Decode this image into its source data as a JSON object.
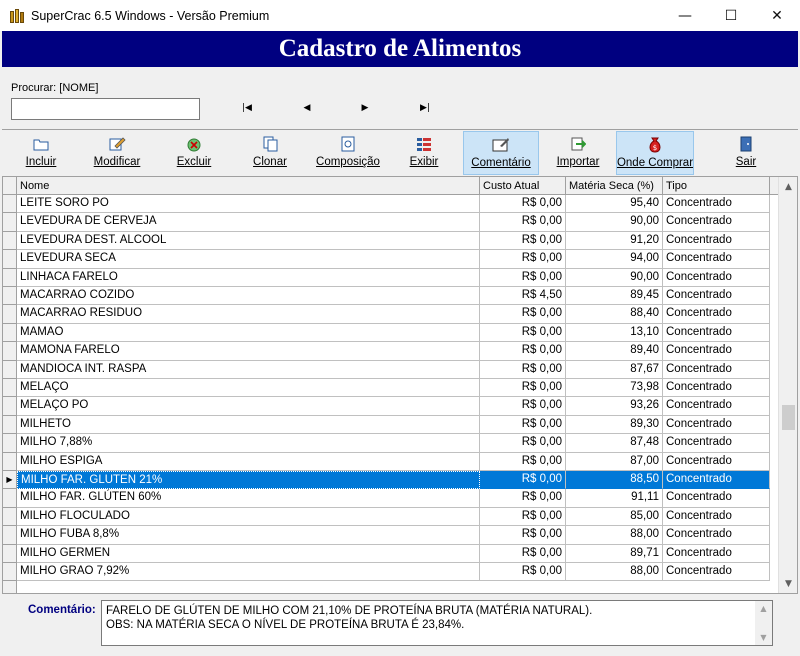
{
  "window": {
    "title": "SuperCrac 6.5 Windows - Versão Premium",
    "minimize": "—",
    "maximize": "☐",
    "close": "✕"
  },
  "banner": {
    "title": "Cadastro de Alimentos"
  },
  "search": {
    "label": "Procurar: [NOME]",
    "value": "",
    "nav": {
      "first": "|◀",
      "prev": "◀",
      "next": "▶",
      "last": "▶|"
    }
  },
  "toolbar": {
    "items": [
      {
        "label": "Incluir",
        "icon": "folder-icon"
      },
      {
        "label": "Modificar",
        "icon": "edit-icon"
      },
      {
        "label": "Excluir",
        "icon": "delete-icon"
      },
      {
        "label": "Clonar",
        "icon": "copy-icon"
      },
      {
        "label": "Composição",
        "icon": "document-icon"
      },
      {
        "label": "Exibir",
        "icon": "list-icon"
      },
      {
        "label": "Comentário",
        "icon": "comment-icon",
        "active": true
      },
      {
        "label": "Importar",
        "icon": "import-icon"
      },
      {
        "label": "Onde Comprar",
        "icon": "money-bag-icon",
        "active": true
      },
      {
        "label": "Sair",
        "icon": "exit-icon"
      }
    ]
  },
  "grid": {
    "columns": [
      "Nome",
      "Custo Atual",
      "Matéria Seca (%)",
      "Tipo"
    ],
    "rows": [
      {
        "nome": "LEITE SORO PO",
        "custo": "R$ 0,00",
        "ms": "95,40",
        "tipo": "Concentrado"
      },
      {
        "nome": "LEVEDURA DE CERVEJA",
        "custo": "R$ 0,00",
        "ms": "90,00",
        "tipo": "Concentrado"
      },
      {
        "nome": "LEVEDURA DEST. ALCOOL",
        "custo": "R$ 0,00",
        "ms": "91,20",
        "tipo": "Concentrado"
      },
      {
        "nome": "LEVEDURA SECA",
        "custo": "R$ 0,00",
        "ms": "94,00",
        "tipo": "Concentrado"
      },
      {
        "nome": "LINHACA FARELO",
        "custo": "R$ 0,00",
        "ms": "90,00",
        "tipo": "Concentrado"
      },
      {
        "nome": "MACARRAO COZIDO",
        "custo": "R$ 4,50",
        "ms": "89,45",
        "tipo": "Concentrado"
      },
      {
        "nome": "MACARRAO RESIDUO",
        "custo": "R$ 0,00",
        "ms": "88,40",
        "tipo": "Concentrado"
      },
      {
        "nome": "MAMAO",
        "custo": "R$ 0,00",
        "ms": "13,10",
        "tipo": "Concentrado"
      },
      {
        "nome": "MAMONA FARELO",
        "custo": "R$ 0,00",
        "ms": "89,40",
        "tipo": "Concentrado"
      },
      {
        "nome": "MANDIOCA INT. RASPA",
        "custo": "R$ 0,00",
        "ms": "87,67",
        "tipo": "Concentrado"
      },
      {
        "nome": "MELAÇO",
        "custo": "R$ 0,00",
        "ms": "73,98",
        "tipo": "Concentrado"
      },
      {
        "nome": "MELAÇO PO",
        "custo": "R$ 0,00",
        "ms": "93,26",
        "tipo": "Concentrado"
      },
      {
        "nome": "MILHETO",
        "custo": "R$ 0,00",
        "ms": "89,30",
        "tipo": "Concentrado"
      },
      {
        "nome": "MILHO 7,88%",
        "custo": "R$ 0,00",
        "ms": "87,48",
        "tipo": "Concentrado"
      },
      {
        "nome": "MILHO ESPIGA",
        "custo": "R$ 0,00",
        "ms": "87,00",
        "tipo": "Concentrado"
      },
      {
        "nome": "MILHO FAR. GLUTEN 21%",
        "custo": "R$ 0,00",
        "ms": "88,50",
        "tipo": "Concentrado",
        "selected": true
      },
      {
        "nome": "MILHO FAR. GLÚTEN 60%",
        "custo": "R$ 0,00",
        "ms": "91,11",
        "tipo": "Concentrado"
      },
      {
        "nome": "MILHO FLOCULADO",
        "custo": "R$ 0,00",
        "ms": "85,00",
        "tipo": "Concentrado"
      },
      {
        "nome": "MILHO FUBA 8,8%",
        "custo": "R$ 0,00",
        "ms": "88,00",
        "tipo": "Concentrado"
      },
      {
        "nome": "MILHO GERMEN",
        "custo": "R$ 0,00",
        "ms": "89,71",
        "tipo": "Concentrado"
      },
      {
        "nome": "MILHO GRAO 7,92%",
        "custo": "R$ 0,00",
        "ms": "88,00",
        "tipo": "Concentrado"
      }
    ],
    "row_indicator": "▶"
  },
  "comment": {
    "label": "Comentário:",
    "line1": "FARELO DE GLÚTEN DE MILHO COM 21,10% DE PROTEÍNA BRUTA (MATÉRIA NATURAL).",
    "line2": "OBS: NA MATÉRIA SECA O NÍVEL DE PROTEÍNA BRUTA É 23,84%."
  },
  "colors": {
    "banner_bg": "#000080",
    "selection": "#0078d7",
    "comment_label": "#000080"
  }
}
